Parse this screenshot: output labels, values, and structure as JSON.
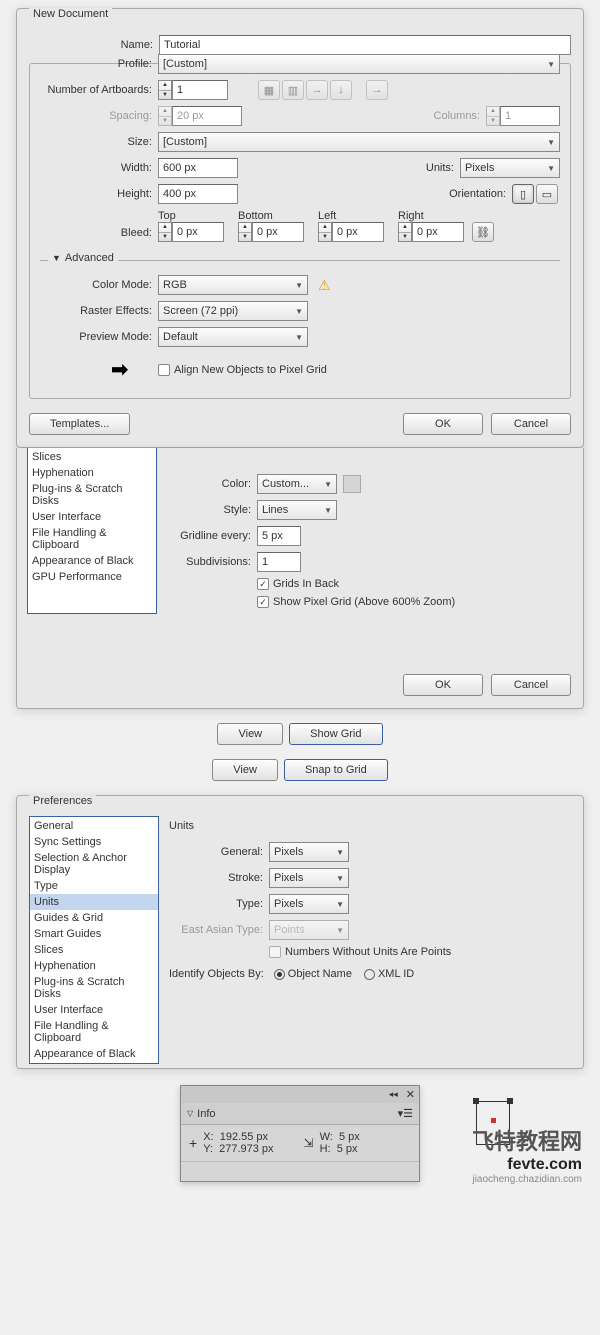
{
  "newdoc": {
    "title": "New Document",
    "name_label": "Name:",
    "name_value": "Tutorial",
    "profile_label": "Profile:",
    "profile_value": "[Custom]",
    "artboards_label": "Number of Artboards:",
    "artboards_value": "1",
    "spacing_label": "Spacing:",
    "spacing_value": "20 px",
    "columns_label": "Columns:",
    "columns_value": "1",
    "size_label": "Size:",
    "size_value": "[Custom]",
    "width_label": "Width:",
    "width_value": "600 px",
    "units_label": "Units:",
    "units_value": "Pixels",
    "height_label": "Height:",
    "height_value": "400 px",
    "orientation_label": "Orientation:",
    "bleed_label": "Bleed:",
    "bleed_top": "Top",
    "bleed_bottom": "Bottom",
    "bleed_left": "Left",
    "bleed_right": "Right",
    "bleed_value": "0 px",
    "advanced_label": "Advanced",
    "colormode_label": "Color Mode:",
    "colormode_value": "RGB",
    "raster_label": "Raster Effects:",
    "raster_value": "Screen (72 ppi)",
    "preview_label": "Preview Mode:",
    "preview_value": "Default",
    "align_label": "Align New Objects to Pixel Grid",
    "templates": "Templates...",
    "ok": "OK",
    "cancel": "Cancel"
  },
  "prefs1": {
    "items": [
      "Slices",
      "Hyphenation",
      "Plug-ins & Scratch Disks",
      "User Interface",
      "File Handling & Clipboard",
      "Appearance of Black",
      "GPU Performance"
    ],
    "color_label": "Color:",
    "color_value": "Custom...",
    "style_label": "Style:",
    "style_value": "Lines",
    "gridline_label": "Gridline every:",
    "gridline_value": "5 px",
    "subdiv_label": "Subdivisions:",
    "subdiv_value": "1",
    "grids_back": "Grids In Back",
    "show_pixel": "Show Pixel Grid (Above 600% Zoom)",
    "ok": "OK",
    "cancel": "Cancel"
  },
  "view_btns": {
    "view": "View",
    "show_grid": "Show Grid",
    "snap": "Snap to Grid"
  },
  "prefs2": {
    "title": "Preferences",
    "items": [
      "General",
      "Sync Settings",
      "Selection & Anchor Display",
      "Type",
      "Units",
      "Guides & Grid",
      "Smart Guides",
      "Slices",
      "Hyphenation",
      "Plug-ins & Scratch Disks",
      "User Interface",
      "File Handling & Clipboard",
      "Appearance of Black"
    ],
    "selected_index": 4,
    "section": "Units",
    "general_label": "General:",
    "general_value": "Pixels",
    "stroke_label": "Stroke:",
    "stroke_value": "Pixels",
    "type_label": "Type:",
    "type_value": "Pixels",
    "east_label": "East Asian Type:",
    "east_value": "Points",
    "nounits": "Numbers Without Units Are Points",
    "identify_label": "Identify Objects By:",
    "obj_name": "Object Name",
    "xml_id": "XML ID"
  },
  "info": {
    "title": "Info",
    "x_label": "X:",
    "x_value": "192.55 px",
    "y_label": "Y:",
    "y_value": "277.973 px",
    "w_label": "W:",
    "w_value": "5 px",
    "h_label": "H:",
    "h_value": "5 px"
  },
  "wm": {
    "a": "飞特教程网",
    "b": "fevte.com",
    "c": "jiaocheng.chazidian.com"
  }
}
